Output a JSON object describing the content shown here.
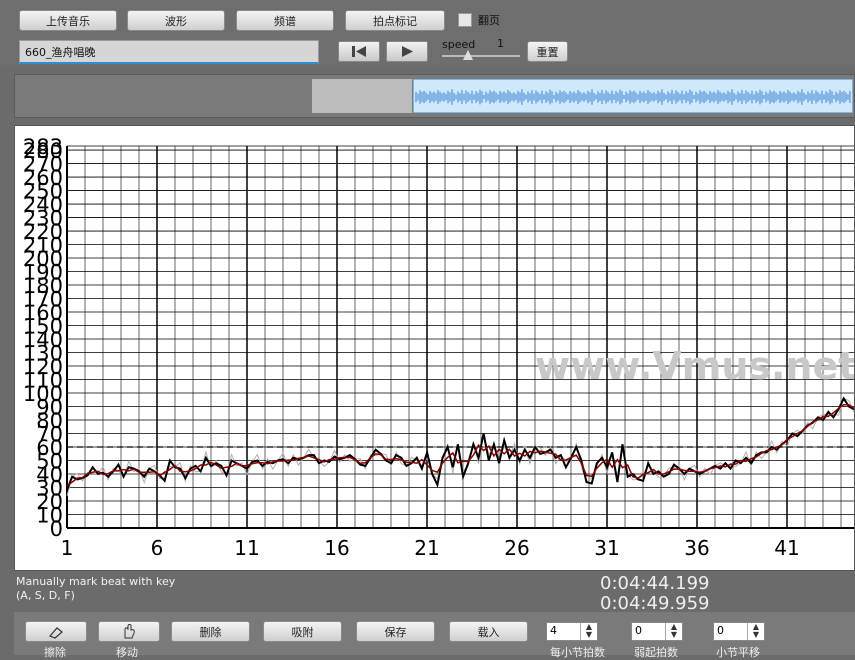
{
  "toolbar": {
    "upload_label": "上传音乐",
    "waveform_label": "波形",
    "spectrum_label": "频谱",
    "beatmark_label": "拍点标记",
    "flip_label": "翻页",
    "flip_checked": false
  },
  "song": {
    "value": "660_渔舟唱晚"
  },
  "playback": {
    "speed_label": "speed",
    "speed_value": "1",
    "reset_label": "重置"
  },
  "chart_data": {
    "type": "line",
    "x_ticks": [
      "1",
      "6",
      "11",
      "16",
      "21",
      "26",
      "31",
      "36",
      "41"
    ],
    "y_ticks": [
      "0",
      "10",
      "20",
      "30",
      "40",
      "50",
      "60",
      "70",
      "80",
      "90",
      "100",
      "110",
      "120",
      "130",
      "140",
      "150",
      "160",
      "170",
      "180",
      "190",
      "200",
      "210",
      "220",
      "230",
      "240",
      "250",
      "260",
      "270",
      "280",
      "283"
    ],
    "ylim": [
      0,
      283
    ],
    "reference_line": 60,
    "watermark": "www.Vmus.net",
    "series": [
      {
        "values": [
          28,
          38,
          36,
          37,
          39,
          45,
          40,
          41,
          38,
          42,
          47,
          38,
          45,
          44,
          42,
          38,
          44,
          42,
          39,
          35,
          50,
          45,
          44,
          37,
          44,
          46,
          42,
          52,
          46,
          48,
          46,
          39,
          50,
          48,
          46,
          44,
          49,
          50,
          46,
          49,
          48,
          50,
          51,
          48,
          52,
          51,
          52,
          54,
          54,
          48,
          50,
          49,
          53,
          51,
          52,
          54,
          51,
          47,
          46,
          52,
          58,
          55,
          50,
          48,
          54,
          52,
          46,
          48,
          52,
          44,
          56,
          40,
          32,
          52,
          60,
          45,
          62,
          38,
          48,
          62,
          52,
          70,
          50,
          62,
          48,
          65,
          52,
          58,
          50,
          58,
          52,
          60,
          55,
          56,
          58,
          52,
          54,
          45,
          52,
          60,
          50,
          34,
          33,
          48,
          52,
          45,
          56,
          34,
          62,
          38,
          40,
          36,
          35,
          48,
          40,
          42,
          38,
          40,
          47,
          44,
          40,
          44,
          42,
          40,
          42,
          44,
          46,
          44,
          48,
          44,
          50,
          48,
          52,
          48,
          54,
          56,
          56,
          60,
          58,
          62,
          65,
          70,
          68,
          72,
          76,
          78,
          82,
          80,
          86,
          82,
          88,
          96,
          90,
          88
        ]
      }
    ]
  },
  "hint": {
    "line1": "Manually mark beat with key",
    "line2": "(A, S, D, F)"
  },
  "times": {
    "current": "0:04:44.199",
    "total": "0:04:49.959"
  },
  "bottom": {
    "clear_label": "擦除",
    "move_label": "移动",
    "delete_label": "删除",
    "snap_label": "吸附",
    "save_label": "保存",
    "load_label": "载入",
    "beats_per_bar_value": "4",
    "beats_per_bar_label": "每小节拍数",
    "pickup_value": "0",
    "pickup_label": "弱起拍数",
    "bar_shift_value": "0",
    "bar_shift_label": "小节平移"
  },
  "colors": {
    "accent": "#2b8fd6",
    "trace": "#000000",
    "smooth": "#8b0000",
    "raw": "#b0b0b0",
    "watermark": "#c8c8c8"
  }
}
